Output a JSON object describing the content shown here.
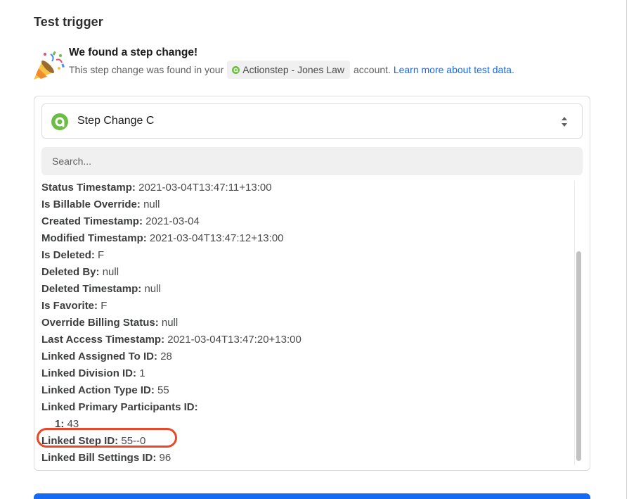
{
  "section": {
    "title": "Test trigger"
  },
  "found": {
    "title": "We found a step change!",
    "desc_before": "This step change was found in your",
    "account_name": "Actionstep - Jones Law",
    "desc_after": "account.",
    "learn_more": "Learn more about test data."
  },
  "selector": {
    "value": "Step Change C",
    "icon": "actionstep-app-icon"
  },
  "search": {
    "placeholder": "Search..."
  },
  "fields": [
    {
      "key": "Status Timestamp:",
      "value": "2021-03-04T13:47:11+13:00"
    },
    {
      "key": "Is Billable Override:",
      "value": "null"
    },
    {
      "key": "Created Timestamp:",
      "value": "2021-03-04"
    },
    {
      "key": "Modified Timestamp:",
      "value": "2021-03-04T13:47:12+13:00"
    },
    {
      "key": "Is Deleted:",
      "value": "F"
    },
    {
      "key": "Deleted By:",
      "value": "null"
    },
    {
      "key": "Deleted Timestamp:",
      "value": "null"
    },
    {
      "key": "Is Favorite:",
      "value": "F"
    },
    {
      "key": "Override Billing Status:",
      "value": "null"
    },
    {
      "key": "Last Access Timestamp:",
      "value": "2021-03-04T13:47:20+13:00"
    },
    {
      "key": "Linked Assigned To ID:",
      "value": "28"
    },
    {
      "key": "Linked Division ID:",
      "value": "1"
    },
    {
      "key": "Linked Action Type ID:",
      "value": "55"
    },
    {
      "key": "Linked Primary Participants ID:",
      "value": ""
    },
    {
      "key": "1:",
      "value": "43"
    },
    {
      "key": "Linked Step ID:",
      "value": "55--0"
    },
    {
      "key": "Linked Bill Settings ID:",
      "value": "96"
    }
  ],
  "colors": {
    "accent_blue": "#136bf5",
    "highlight_red": "#e8472a",
    "actionstep_green": "#6bbd45"
  }
}
